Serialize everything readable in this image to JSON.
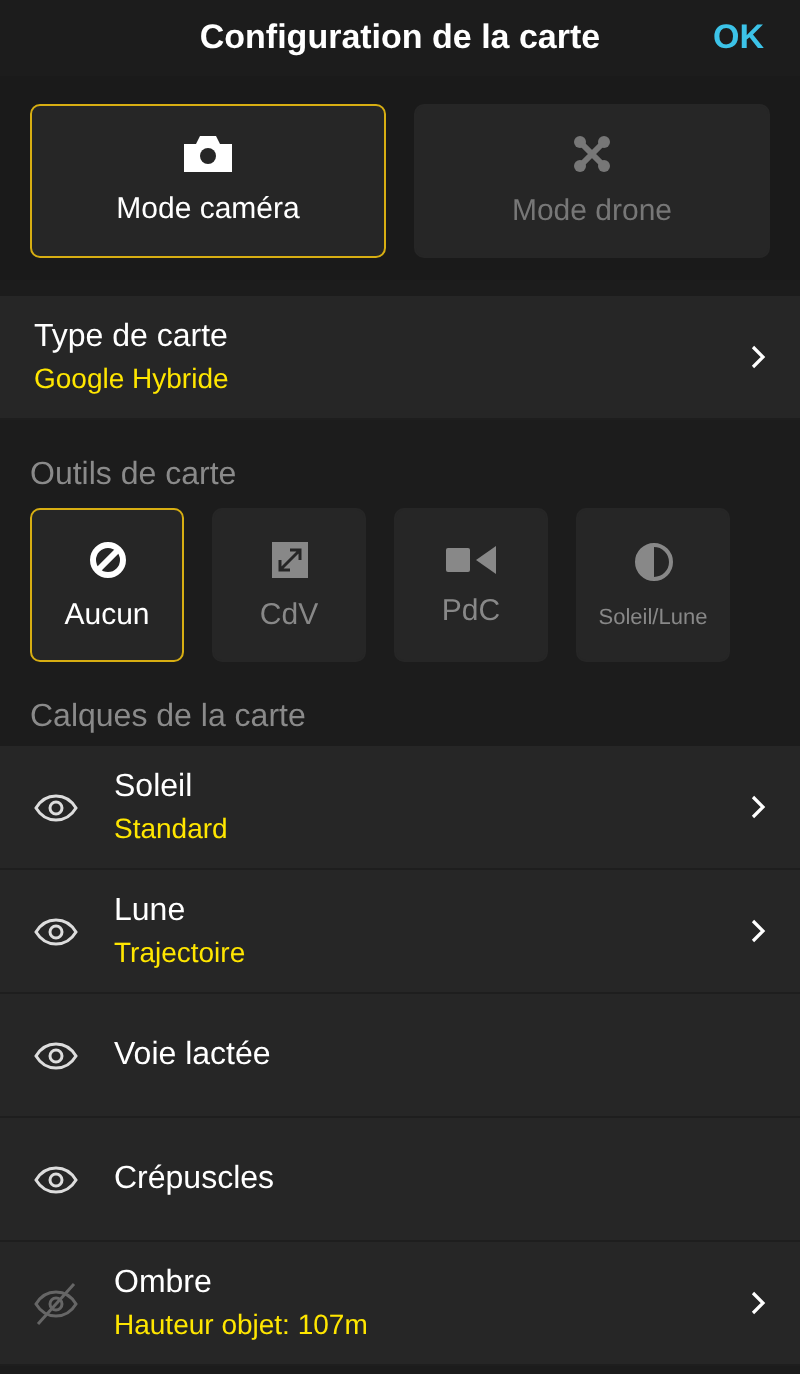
{
  "header": {
    "title": "Configuration de la carte",
    "done": "OK"
  },
  "modes": [
    {
      "label": "Mode caméra",
      "kind": "camera",
      "selected": true
    },
    {
      "label": "Mode drone",
      "kind": "drone",
      "selected": false
    }
  ],
  "map_type": {
    "label": "Type de carte",
    "value": "Google Hybride"
  },
  "tools_section": {
    "title": "Outils de carte"
  },
  "tools": [
    {
      "label": "Aucun",
      "kind": "none",
      "selected": true
    },
    {
      "label": "CdV",
      "kind": "field",
      "selected": false
    },
    {
      "label": "PdC",
      "kind": "viewpoint",
      "selected": false
    },
    {
      "label": "Soleil/Lune",
      "kind": "sunmoon",
      "selected": false
    }
  ],
  "layers_section": {
    "title": "Calques de la carte"
  },
  "layers": [
    {
      "name": "Soleil",
      "detail": "Standard",
      "visible": true,
      "expandable": true
    },
    {
      "name": "Lune",
      "detail": "Trajectoire",
      "visible": true,
      "expandable": true
    },
    {
      "name": "Voie lactée",
      "visible": true,
      "expandable": false
    },
    {
      "name": "Crépuscles",
      "visible": true,
      "expandable": false
    },
    {
      "name": "Ombre",
      "detail": "Hauteur objet: 107m",
      "visible": false,
      "expandable": true
    }
  ]
}
